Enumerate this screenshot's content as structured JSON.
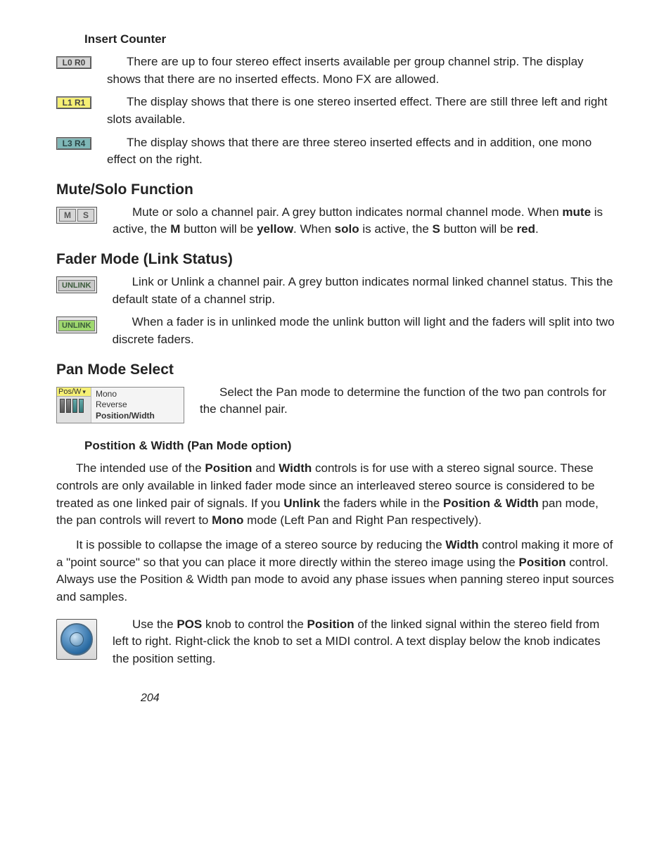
{
  "insertCounter": {
    "heading": "Insert Counter",
    "items": [
      {
        "badge": "L0 R0",
        "style": "grey",
        "text": "There are up to four stereo effect inserts available per group channel strip. The display shows that there are no inserted effects. Mono FX are allowed."
      },
      {
        "badge": "L1 R1",
        "style": "yellow",
        "text": "The display shows that there is one stereo inserted effect. There are still three left and right slots available."
      },
      {
        "badge": "L3 R4",
        "style": "teal",
        "text": "The display shows that there are three stereo inserted effects and in addition, one mono effect on the right."
      }
    ]
  },
  "muteSolo": {
    "heading": "Mute/Solo Function",
    "buttons": {
      "m": "M",
      "s": "S"
    },
    "text_pre": "Mute or solo a channel pair. A grey button indicates normal channel mode. When ",
    "t_mute": "mute",
    "t_mid1": " is active, the ",
    "t_M": "M",
    "t_mid2": " button will be ",
    "t_yellow": "yellow",
    "t_mid3": ". When ",
    "t_solo": "solo",
    "t_mid4": " is active, the ",
    "t_S": "S",
    "t_mid5": " button will be ",
    "t_red": "red",
    "t_end": "."
  },
  "faderMode": {
    "heading": "Fader Mode (Link Status)",
    "btnLabel": "UNLINK",
    "linked_text": "Link or Unlink a channel pair. A grey button indicates normal linked channel status. This the default state of a channel strip.",
    "unlinked_text": "When a fader is in unlinked mode the unlink button will light and the faders will split into two discrete faders."
  },
  "panMode": {
    "heading": "Pan Mode Select",
    "tag": "Pos/W",
    "menu": {
      "opt1": "Mono",
      "opt2": "Reverse",
      "opt3": "Position/Width"
    },
    "text": "Select the Pan mode to determine the function of the two pan controls for the channel pair."
  },
  "posWidth": {
    "heading": "Postition & Width (Pan Mode option)",
    "p1_a": "The intended use of the ",
    "p1_b": "Position",
    "p1_c": " and ",
    "p1_d": "Width",
    "p1_e": " controls is for use with a stereo signal source.  These controls are only available in linked fader mode since an interleaved stereo source is considered to be treated as one linked pair of signals. If you ",
    "p1_f": "Unlink",
    "p1_g": " the faders while in the ",
    "p1_h": "Position & Width",
    "p1_i": " pan mode, the pan controls will revert to ",
    "p1_j": "Mono",
    "p1_k": " mode (Left Pan and Right Pan respectively).",
    "p2_a": "It is possible to collapse the image of a stereo source by reducing the ",
    "p2_b": "Width",
    "p2_c": " control making it more of a \"point source\" so that you can place it more directly within the stereo image using the ",
    "p2_d": "Position",
    "p2_e": " control. Always use the Position & Width pan mode to avoid any phase issues when panning stereo input sources and samples."
  },
  "posKnob": {
    "t1": "Use the ",
    "t2": "POS",
    "t3": " knob to control the ",
    "t4": "Position",
    "t5": " of the linked signal within the stereo field from left to right. Right-click the knob to set a MIDI control. A text display below the knob indicates the position setting."
  },
  "pageNumber": "204"
}
